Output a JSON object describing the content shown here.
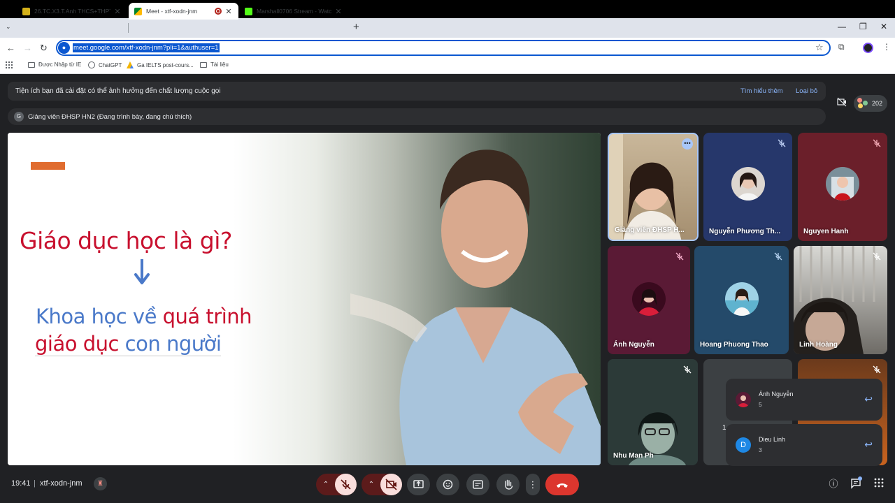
{
  "browser": {
    "tabs": [
      {
        "title": "26.TC.X3.T.Anh THCS+THPT – L",
        "favicon_color": "#d4b11a",
        "active": false
      },
      {
        "title": "Meet - xtf-xodn-jnm",
        "favicon_color": "#00832d",
        "active": true
      },
      {
        "title": "Marshall0706 Stream - Watch L",
        "favicon_color": "#53fc18",
        "active": false
      }
    ],
    "url": "meet.google.com/xtf-xodn-jnm?pli=1&authuser=1",
    "bookmarks": [
      "Được Nhập từ IE",
      "ChatGPT",
      "Ga IELTS post-cours...",
      "Tài liệu"
    ]
  },
  "meet": {
    "banner": {
      "text": "Tiện ích bạn đã cài đặt có thể ảnh hưởng đến chất lượng cuộc gọi",
      "learn_more": "Tìm hiểu thêm",
      "dismiss": "Loại bỏ"
    },
    "presenter": {
      "initial": "G",
      "label": "Giảng viên ĐHSP HN2 (Đang trình bày, đang chú thích)"
    },
    "participant_count": "202",
    "slide": {
      "title": "Giáo dục học là gì?",
      "line1_a": "Khoa học về ",
      "line1_b": "quá trình",
      "line2_a": "giáo dục ",
      "line2_b": "con người"
    },
    "tiles": [
      {
        "name": "Giảng viên ĐHSP H...",
        "bg": "#b8a58a",
        "speaking": true
      },
      {
        "name": "Nguyễn Phương Th...",
        "bg": "#26376b"
      },
      {
        "name": "Nguyen Hanh",
        "bg": "#6b1f2a"
      },
      {
        "name": "Ánh Nguyễn",
        "bg": "#5a1a35"
      },
      {
        "name": "Hoang Phuong Thao",
        "bg": "#244a6a"
      },
      {
        "name": "Linh Hoàng",
        "bg": "#8c8c8a"
      },
      {
        "name": "Nhu Man Ph",
        "bg": "#2b3a3a"
      },
      {
        "name": "",
        "bg": "#3c4043"
      },
      {
        "name": "",
        "bg": "#b5561c"
      }
    ],
    "partial_text": "1",
    "notifications": [
      {
        "name": "Ánh Nguyễn",
        "count": "5"
      },
      {
        "name": "Dieu Linh",
        "count": "3",
        "initial": "D"
      }
    ],
    "bottom": {
      "time": "19:41",
      "separator": "|",
      "meeting_code": "xtf-xodn-jnm"
    }
  }
}
